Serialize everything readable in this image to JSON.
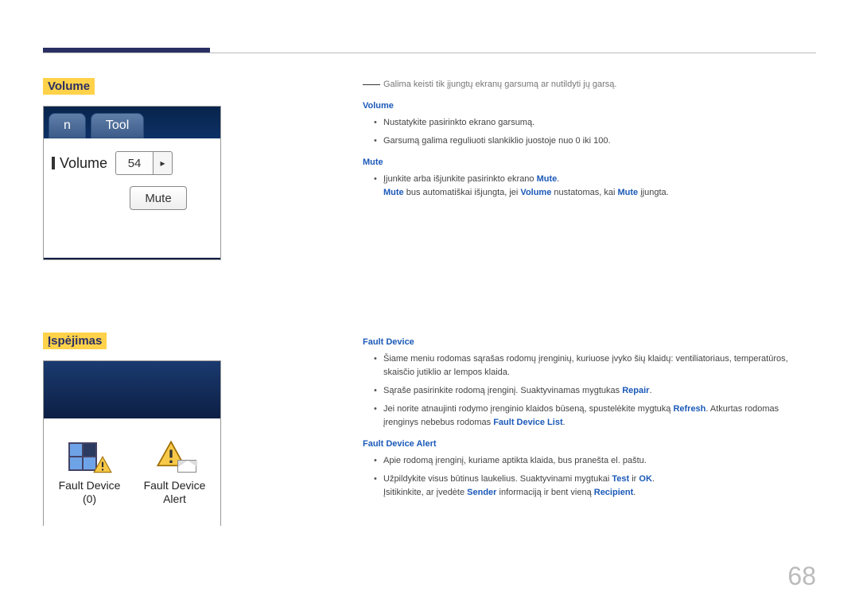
{
  "page_number": "68",
  "section1": {
    "left": {
      "heading": "Volume",
      "shot": {
        "tab1": "n",
        "tab2": "Tool",
        "volume_label": "Volume",
        "volume_value": "54",
        "mute_label": "Mute"
      }
    },
    "right": {
      "intro_note": "Galima keisti tik įjungtų ekranų garsumą ar nutildyti jų garsą.",
      "volume": {
        "heading": "Volume",
        "bullets": [
          "Nustatykite pasirinkto ekrano garsumą.",
          "Garsumą galima reguliuoti slankiklio juostoje nuo 0 iki 100."
        ]
      },
      "mute": {
        "heading": "Mute",
        "line1_a": "Įjunkite arba išjunkite pasirinkto ekrano ",
        "line1_b": ".",
        "line2_a": " bus automatiškai išjungta, jei ",
        "line2_b": " nustatomas, kai ",
        "line2_c": " įjungta.",
        "kw_mute": "Mute",
        "kw_volume": "Volume"
      }
    }
  },
  "section2": {
    "left": {
      "heading": "Įspėjimas",
      "shot": {
        "item1_line1": "Fault Device",
        "item1_line2": "(0)",
        "item2_line1": "Fault Device",
        "item2_line2": "Alert"
      }
    },
    "right": {
      "dot": ".",
      "fault_device": {
        "heading": "Fault Device",
        "bullets": [
          "Šiame meniu rodomas sąrašas rodomų įrenginių, kuriuose įvyko šių klaidų: ventiliatoriaus, temperatūros, skaisčio jutiklio ar lempos klaida."
        ],
        "b1_a": "Sąraše pasirinkite rodomą įrenginį. Suaktyvinamas mygtukas ",
        "kw_repair": "Repair",
        "b2_a": "Jei norite atnaujinti rodymo įrenginio klaidos būseną, spustelėkite mygtuką ",
        "kw_refresh": "Refresh",
        "b2_b": ". Atkurtas rodomas įrenginys nebebus rodomas ",
        "kw_fdlist": "Fault Device List"
      },
      "fault_alert": {
        "heading": "Fault Device Alert",
        "bullets": [
          "Apie rodomą įrenginį, kuriame aptikta klaida, bus pranešta el. paštu."
        ],
        "b1_a": "Užpildykite visus būtinus laukelius. Suaktyvinami mygtukai ",
        "kw_test": "Test",
        "b1_b": " ir ",
        "kw_ok": "OK",
        "b2_a": "Įsitikinkite, ar įvedėte ",
        "kw_sender": "Sender",
        "b2_b": " informaciją ir bent vieną ",
        "kw_recipient": "Recipient"
      }
    }
  }
}
